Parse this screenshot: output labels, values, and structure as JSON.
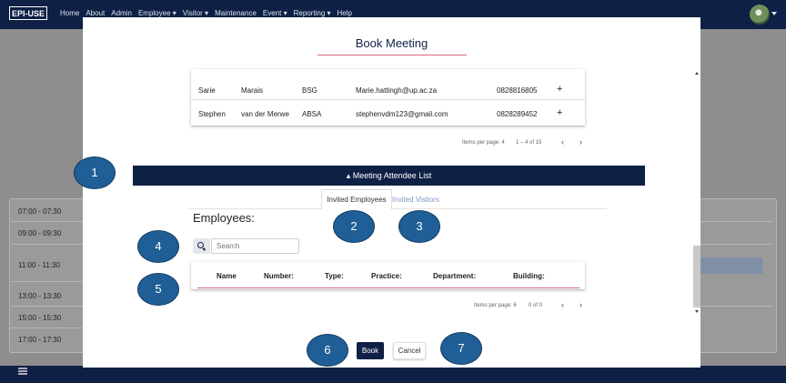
{
  "app": {
    "logo_text": "EPI-USE",
    "nav": [
      "Home",
      "About",
      "Admin",
      "Employee ▾",
      "Visitor ▾",
      "Maintenance",
      "Event ▾",
      "Reporting ▾",
      "Help"
    ]
  },
  "background": {
    "time_slots": [
      "07:00 - 07:30",
      "09:00 - 09:30",
      "11:00 - 11:30",
      "13:00 - 13:30",
      "15:00 - 15:30",
      "17:00 - 17:30"
    ]
  },
  "modal": {
    "title": "Book Meeting",
    "contacts": [
      {
        "first": "Sarie",
        "last": "Marais",
        "company": "BSG",
        "email": "Marie.hattingh@up.ac.za",
        "phone": "0828816805",
        "action": "+"
      },
      {
        "first": "Stephen",
        "last": "van der Merwe",
        "company": "ABSA",
        "email": "stephenvdm123@gmail.com",
        "phone": "0828289452",
        "action": "+"
      }
    ],
    "contacts_pager": {
      "items_per_page_label": "Items per page: 4",
      "range": "1 – 4 of 15"
    },
    "section_title": "▴ Meeting Attendee List",
    "tabs": [
      "Invited Employees",
      "Invited Visitors"
    ],
    "employees_heading": "Employees:",
    "search": {
      "placeholder": "Search"
    },
    "employee_columns": [
      "Name",
      "Number:",
      "Type:",
      "Practice:",
      "Department:",
      "Building:"
    ],
    "employees_pager": {
      "items_per_page_label": "Items per page: 6",
      "range": "0 of 0"
    },
    "actions": {
      "book": "Book",
      "cancel": "Cancel"
    }
  },
  "callouts": [
    "1",
    "2",
    "3",
    "4",
    "5",
    "6",
    "7"
  ],
  "colors": {
    "navy": "#0e2045",
    "callout_blue": "#1f5e96",
    "accent_pink": "#d46a7a",
    "tab_link": "#7e97c6"
  }
}
